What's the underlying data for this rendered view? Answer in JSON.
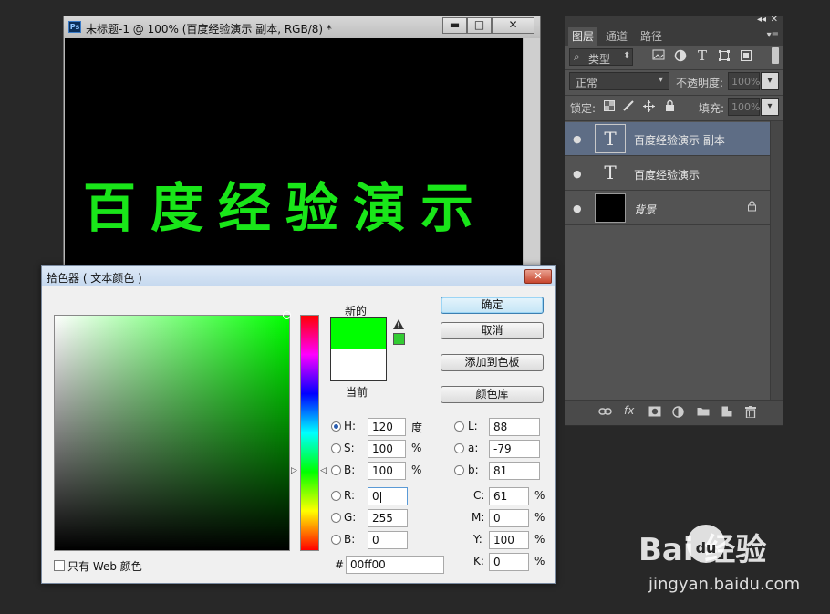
{
  "document": {
    "ps_badge": "Ps",
    "title": "未标题-1 @ 100% (百度经验演示 副本, RGB/8) *",
    "controls": {
      "minimize": "▬",
      "maximize": "□",
      "close": "✕"
    },
    "canvas_text": "百度经验演示",
    "canvas_text_color": "#19e619"
  },
  "layers_panel": {
    "top_controls": {
      "collapse": "◂◂",
      "close": "✕"
    },
    "tabs": [
      "图层",
      "通道",
      "路径"
    ],
    "menu_icon": "▾≡",
    "filter": {
      "search_icon": "⌕",
      "kind": "类型",
      "arrow": "⬍"
    },
    "filter_icons": [
      "image-icon",
      "adjustment-icon",
      "type-icon",
      "shape-icon",
      "smart-object-icon"
    ],
    "blend_mode": "正常",
    "opacity_label": "不透明度:",
    "opacity_value": "100%",
    "lock_label": "锁定:",
    "fill_label": "填充:",
    "fill_value": "100%",
    "dropdown_arrow": "▾",
    "layers": [
      {
        "name": "百度经验演示 副本",
        "thumb": "T",
        "selected": true
      },
      {
        "name": "百度经验演示",
        "thumb": "T",
        "selected": false
      },
      {
        "name": "背景",
        "thumb": "",
        "selected": false,
        "locked": true
      }
    ],
    "bottom_icons": [
      "link-icon",
      "fx-icon",
      "mask-icon",
      "adjustment-layer-icon",
      "group-icon",
      "new-layer-icon",
      "trash-icon"
    ],
    "fx_label": "fx"
  },
  "picker": {
    "title": "拾色器 ( 文本颜色 )",
    "close_glyph": "✕",
    "new_label": "新的",
    "current_label": "当前",
    "new_color": "#00ff00",
    "current_color": "#ffffff",
    "buttons": {
      "ok": "确定",
      "cancel": "取消",
      "add_swatch": "添加到色板",
      "libraries": "颜色库"
    },
    "hsb": {
      "h": {
        "label": "H:",
        "value": "120",
        "unit": "度"
      },
      "s": {
        "label": "S:",
        "value": "100",
        "unit": "%"
      },
      "b": {
        "label": "B:",
        "value": "100",
        "unit": "%"
      }
    },
    "rgb": {
      "r": {
        "label": "R:",
        "value": "0"
      },
      "g": {
        "label": "G:",
        "value": "255"
      },
      "b": {
        "label": "B:",
        "value": "0"
      }
    },
    "lab": {
      "l": {
        "label": "L:",
        "value": "88"
      },
      "a": {
        "label": "a:",
        "value": "-79"
      },
      "b": {
        "label": "b:",
        "value": "81"
      }
    },
    "cmyk": {
      "c": {
        "label": "C:",
        "value": "61",
        "unit": "%"
      },
      "m": {
        "label": "M:",
        "value": "0",
        "unit": "%"
      },
      "y": {
        "label": "Y:",
        "value": "100",
        "unit": "%"
      },
      "k": {
        "label": "K:",
        "value": "0",
        "unit": "%"
      }
    },
    "hex_label": "#",
    "hex_value": "00ff00",
    "web_only_label": "只有 Web 颜色",
    "web_safe_color": "#33cc33"
  },
  "watermark": {
    "logo": "Bai  经验",
    "paw": "du",
    "url": "jingyan.baidu.com"
  }
}
